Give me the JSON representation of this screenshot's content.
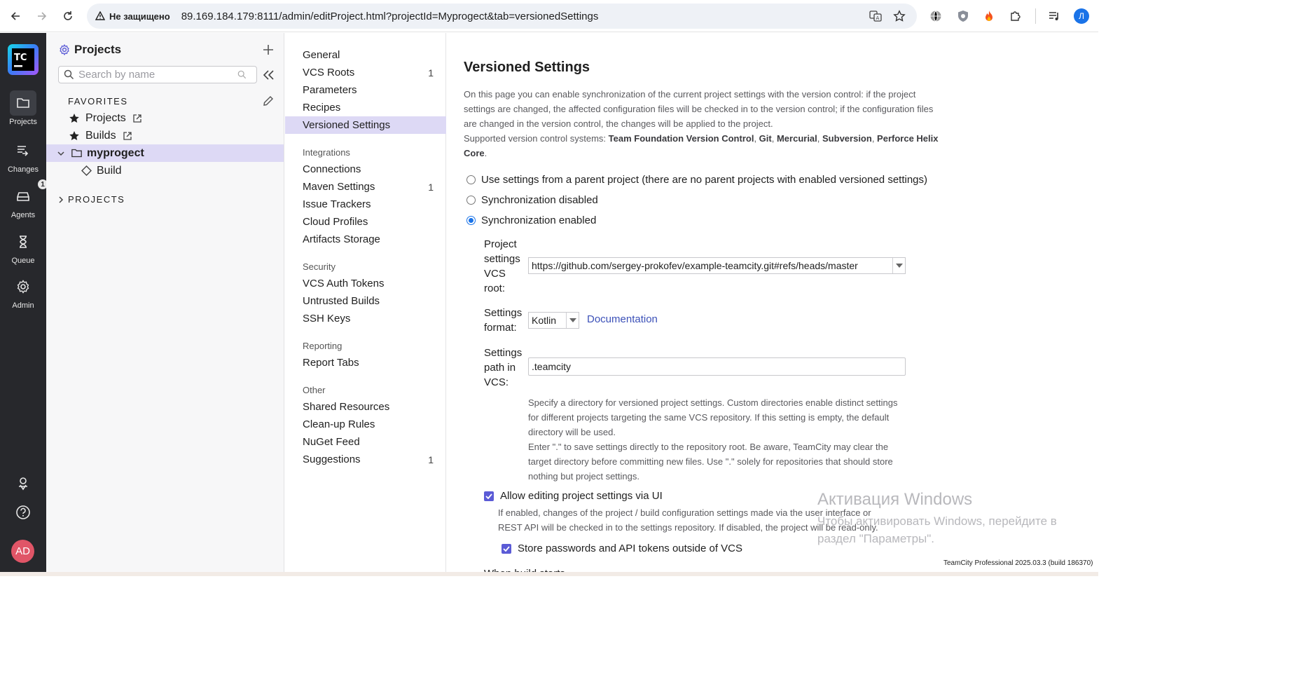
{
  "browser": {
    "security_label": "Не защищено",
    "url": "89.169.184.179:8111/admin/editProject.html?projectId=Myprogect&tab=versionedSettings",
    "profile_initial": "Л"
  },
  "rail": {
    "logo": "TC",
    "items": [
      {
        "label": "Projects",
        "icon": "folder-icon"
      },
      {
        "label": "Changes",
        "icon": "changes-icon"
      },
      {
        "label": "Agents",
        "icon": "agents-icon",
        "badge": "1"
      },
      {
        "label": "Queue",
        "icon": "hourglass-icon"
      },
      {
        "label": "Admin",
        "icon": "gear-icon"
      }
    ],
    "avatar": "AD"
  },
  "sidebar": {
    "title": "Projects",
    "search_placeholder": "Search by name",
    "favorites_label": "FAVORITES",
    "favorites": [
      {
        "label": "Projects"
      },
      {
        "label": "Builds"
      }
    ],
    "project": {
      "label": "myprogect"
    },
    "build": {
      "label": "Build"
    },
    "projects_label": "PROJECTS"
  },
  "menu": {
    "items": [
      {
        "label": "General",
        "count": ""
      },
      {
        "label": "VCS Roots",
        "count": "1"
      },
      {
        "label": "Parameters",
        "count": ""
      },
      {
        "label": "Recipes",
        "count": ""
      },
      {
        "label": "Versioned Settings",
        "count": ""
      }
    ],
    "sections": [
      {
        "title": "Integrations",
        "items": [
          {
            "label": "Connections",
            "count": ""
          },
          {
            "label": "Maven Settings",
            "count": "1"
          },
          {
            "label": "Issue Trackers",
            "count": ""
          },
          {
            "label": "Cloud Profiles",
            "count": ""
          },
          {
            "label": "Artifacts Storage",
            "count": ""
          }
        ]
      },
      {
        "title": "Security",
        "items": [
          {
            "label": "VCS Auth Tokens",
            "count": ""
          },
          {
            "label": "Untrusted Builds",
            "count": ""
          },
          {
            "label": "SSH Keys",
            "count": ""
          }
        ]
      },
      {
        "title": "Reporting",
        "items": [
          {
            "label": "Report Tabs",
            "count": ""
          }
        ]
      },
      {
        "title": "Other",
        "items": [
          {
            "label": "Shared Resources",
            "count": ""
          },
          {
            "label": "Clean-up Rules",
            "count": ""
          },
          {
            "label": "NuGet Feed",
            "count": ""
          },
          {
            "label": "Suggestions",
            "count": "1"
          }
        ]
      }
    ]
  },
  "main": {
    "title": "Versioned Settings",
    "intro": "On this page you can enable synchronization of the current project settings with the version control: if the project settings are changed, the affected configuration files will be checked in to the version control; if the configuration files are changed in the version control, the changes will be applied to the project.",
    "supported_prefix": "Supported version control systems:",
    "vcs_systems": [
      "Team Foundation Version Control",
      "Git",
      "Mercurial",
      "Subversion",
      "Perforce Helix Core"
    ],
    "radio_options": [
      {
        "label": "Use settings from a parent project (there are no parent projects with enabled versioned settings)",
        "checked": false
      },
      {
        "label": "Synchronization disabled",
        "checked": false
      },
      {
        "label": "Synchronization enabled",
        "checked": true
      }
    ],
    "vcs_root_label": "Project settings VCS root:",
    "vcs_root_value": "https://github.com/sergey-prokofev/example-teamcity.git#refs/heads/master",
    "format_label": "Settings format:",
    "format_value": "Kotlin",
    "documentation_link": "Documentation",
    "path_label": "Settings path in VCS:",
    "path_value": ".teamcity",
    "path_help_1": "Specify a directory for versioned project settings. Custom directories enable distinct settings for different projects targeting the same VCS repository. If this setting is empty, the default directory will be used.",
    "path_help_2": "Enter \".\" to save settings directly to the repository root. Be aware, TeamCity may clear the target directory before committing new files. Use \".\" solely for repositories that should store nothing but project settings.",
    "allow_ui_label": "Allow editing project settings via UI",
    "allow_ui_desc": "If enabled, changes of the project / build configuration settings made via the user interface or REST API will be checked in to the settings repository. If disabled, the project will be read-only.",
    "store_passwords_label": "Store passwords and API tokens outside of VCS",
    "cut_off_label": "When build starts"
  },
  "watermark": {
    "title": "Активация Windows",
    "subtitle": "Чтобы активировать Windows, перейдите в раздел \"Параметры\"."
  },
  "footer": {
    "version": "TeamCity Professional 2025.03.3 (build 186370)"
  },
  "colors": {
    "accent": "#5b5bd6",
    "selection": "#ddd9f5",
    "rail": "#27282c",
    "link": "#3c51b8"
  }
}
